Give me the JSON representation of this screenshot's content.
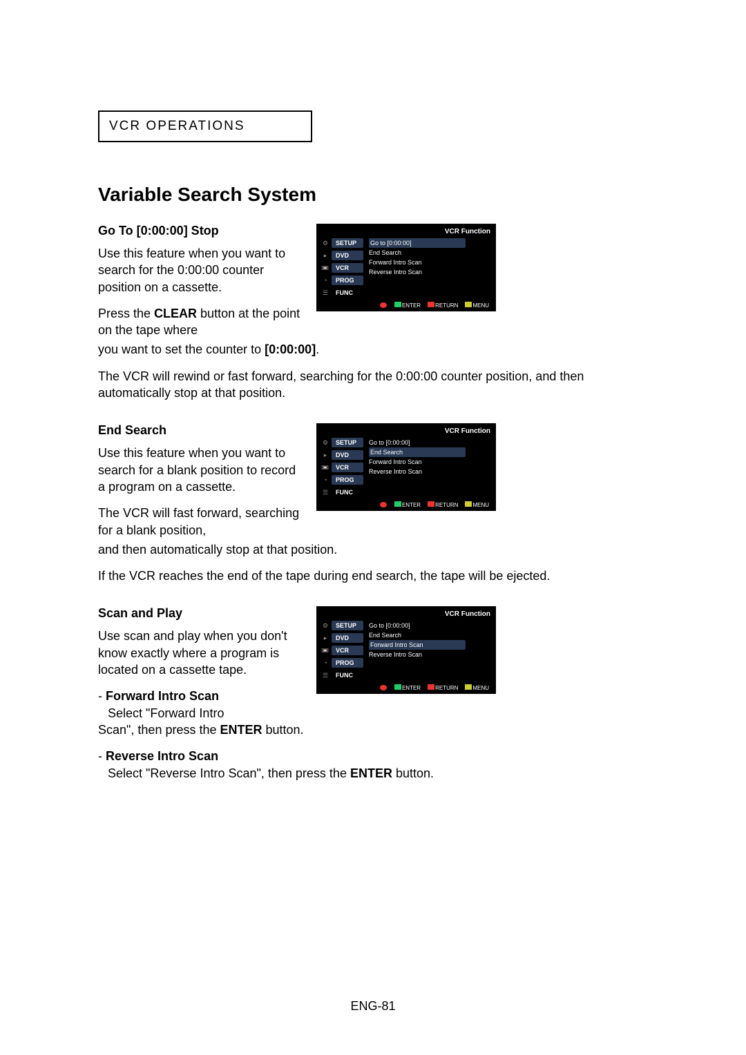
{
  "header": {
    "pre": "VCR O",
    "rest": "PERATIONS"
  },
  "title": "Variable Search System",
  "s1": {
    "heading": "Go To [0:00:00] Stop",
    "p1a": "Use this feature when you want to search for the 0:00:00 counter position on a cassette.",
    "p1b_pre": "Press the ",
    "p1b_bold": "CLEAR",
    "p1b_mid": " button at the point on the tape where you want to set the counter to ",
    "p1b_bold2": "[0:00:00]",
    "p1b_end": ".",
    "p2": "The VCR will rewind or fast forward, searching for the 0:00:00 counter position, and then automatically stop at that position."
  },
  "s2": {
    "heading": "End Search",
    "p1": "Use this feature when you want to search for a blank position to record a program on a cassette.",
    "p2": "The VCR will fast forward, searching for a blank position, and then automatically stop at that position.",
    "p3": "If the VCR reaches the end of the tape during end search, the tape will be ejected."
  },
  "s3": {
    "heading": "Scan and Play",
    "p1": "Use scan and play when you don't know exactly where a program is located on a cassette tape.",
    "fw_title": "Forward Intro Scan",
    "fw_body_pre": "Select \"Forward Intro Scan\", then press the ",
    "fw_body_bold": "ENTER",
    "fw_body_end": " button.",
    "rv_title": "Reverse Intro Scan",
    "rv_body_pre": "Select \"Reverse Intro Scan\", then press the ",
    "rv_body_bold": "ENTER",
    "rv_body_end": " button."
  },
  "osd": {
    "topLabel": "VCR Function",
    "side": [
      "SETUP",
      "DVD",
      "VCR",
      "PROG",
      "FUNC"
    ],
    "menu": [
      "Go to [0:00:00]",
      "End Search",
      "Forward Intro Scan",
      "Reverse Intro Scan"
    ],
    "bottom": [
      "ENTER",
      "RETURN",
      "MENU"
    ],
    "hl1": 0,
    "hl2": 1,
    "hl3": 2
  },
  "footer": "ENG-81"
}
